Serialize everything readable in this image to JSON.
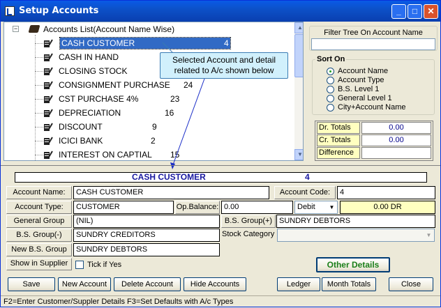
{
  "window": {
    "title": "Setup Accounts",
    "min": "_",
    "max": "□",
    "close": "✕"
  },
  "tree": {
    "root_label": "Accounts List(Account Name Wise)",
    "items": [
      {
        "name": "CASH CUSTOMER",
        "code": "4"
      },
      {
        "name": "CASH IN HAND",
        "code": ""
      },
      {
        "name": "CLOSING STOCK",
        "code": ""
      },
      {
        "name": "CONSIGNMENT PURCHASE",
        "code": "24"
      },
      {
        "name": "CST PURCHASE 4%",
        "code": "23"
      },
      {
        "name": "DEPRECIATION",
        "code": "16"
      },
      {
        "name": "DISCOUNT",
        "code": "9"
      },
      {
        "name": "ICICI BANK",
        "code": "2"
      },
      {
        "name": "INTEREST ON CAPTIAL",
        "code": "15"
      }
    ]
  },
  "callout": "Selected Account and detail related to  A/c shown below",
  "filter": {
    "label": "Filter Tree On Account Name",
    "value": ""
  },
  "sort": {
    "title": "Sort On",
    "options": [
      "Account Name",
      "Account Type",
      "B.S. Level 1",
      "General Level 1",
      "City+Account Name"
    ],
    "selected": "Account Name"
  },
  "totals": {
    "dr_label": "Dr. Totals",
    "dr_value": "0.00",
    "cr_label": "Cr. Totals",
    "cr_value": "0.00",
    "diff_label": "Difference",
    "diff_value": ""
  },
  "header": {
    "name": "CASH CUSTOMER",
    "code": "4"
  },
  "form": {
    "account_name_label": "Account Name:",
    "account_name": "CASH CUSTOMER",
    "account_code_label": "Account Code:",
    "account_code": "4",
    "account_type_label": "Account Type:",
    "account_type": "CUSTOMER",
    "op_balance_label": "Op.Balance:",
    "op_balance": "0.00",
    "drcr": "Debit",
    "balance_display": "0.00 DR",
    "general_group_label": "General Group",
    "general_group": "(NIL)",
    "bs_plus_label": "B.S. Group(+)",
    "bs_plus": "SUNDRY DEBTORS",
    "bs_minus_label": "B.S. Group(-)",
    "bs_minus": "SUNDRY CREDITORS",
    "stock_cat_label": "Stock Category",
    "stock_cat": "",
    "new_bs_label": "New B.S. Group",
    "new_bs": "SUNDRY DEBTORS",
    "show_supplier_label": "Show in Supplier",
    "tick_label": "Tick if Yes",
    "other_details": "Other Details"
  },
  "buttons": {
    "save": "Save",
    "new_account": "New Account",
    "delete_account": "Delete Account",
    "hide_accounts": "Hide Accounts",
    "ledger": "Ledger",
    "month_totals": "Month Totals",
    "close": "Close"
  },
  "status": "F2=Enter Customer/Suppler Details   F3=Set Defaults with A/c Types"
}
